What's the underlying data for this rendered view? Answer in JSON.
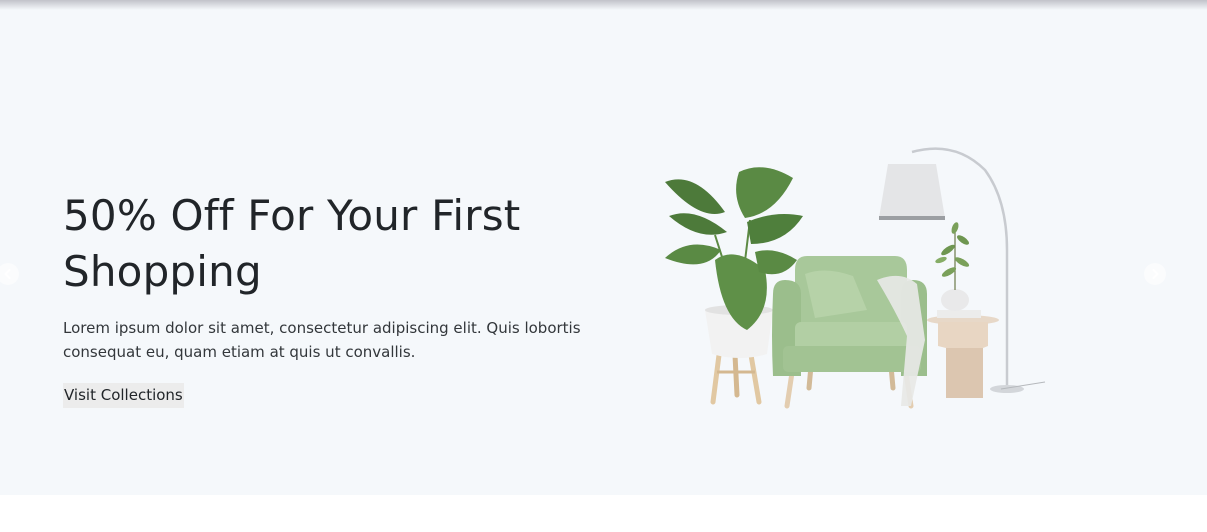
{
  "hero": {
    "headline": "50% Off For Your First Shopping",
    "description": "Lorem ipsum dolor sit amet, consectetur adipiscing elit. Quis lobortis consequat eu, quam etiam at quis ut convallis.",
    "cta_label": "Visit Collections"
  },
  "carousel": {
    "prev_icon": "chevron-left-icon",
    "next_icon": "chevron-right-icon"
  },
  "colors": {
    "hero_background": "#f5f8fb",
    "text": "#212529",
    "cta_background": "#ececec",
    "armchair_green": "#a8c89a",
    "plant_green": "#4d7a3a"
  }
}
